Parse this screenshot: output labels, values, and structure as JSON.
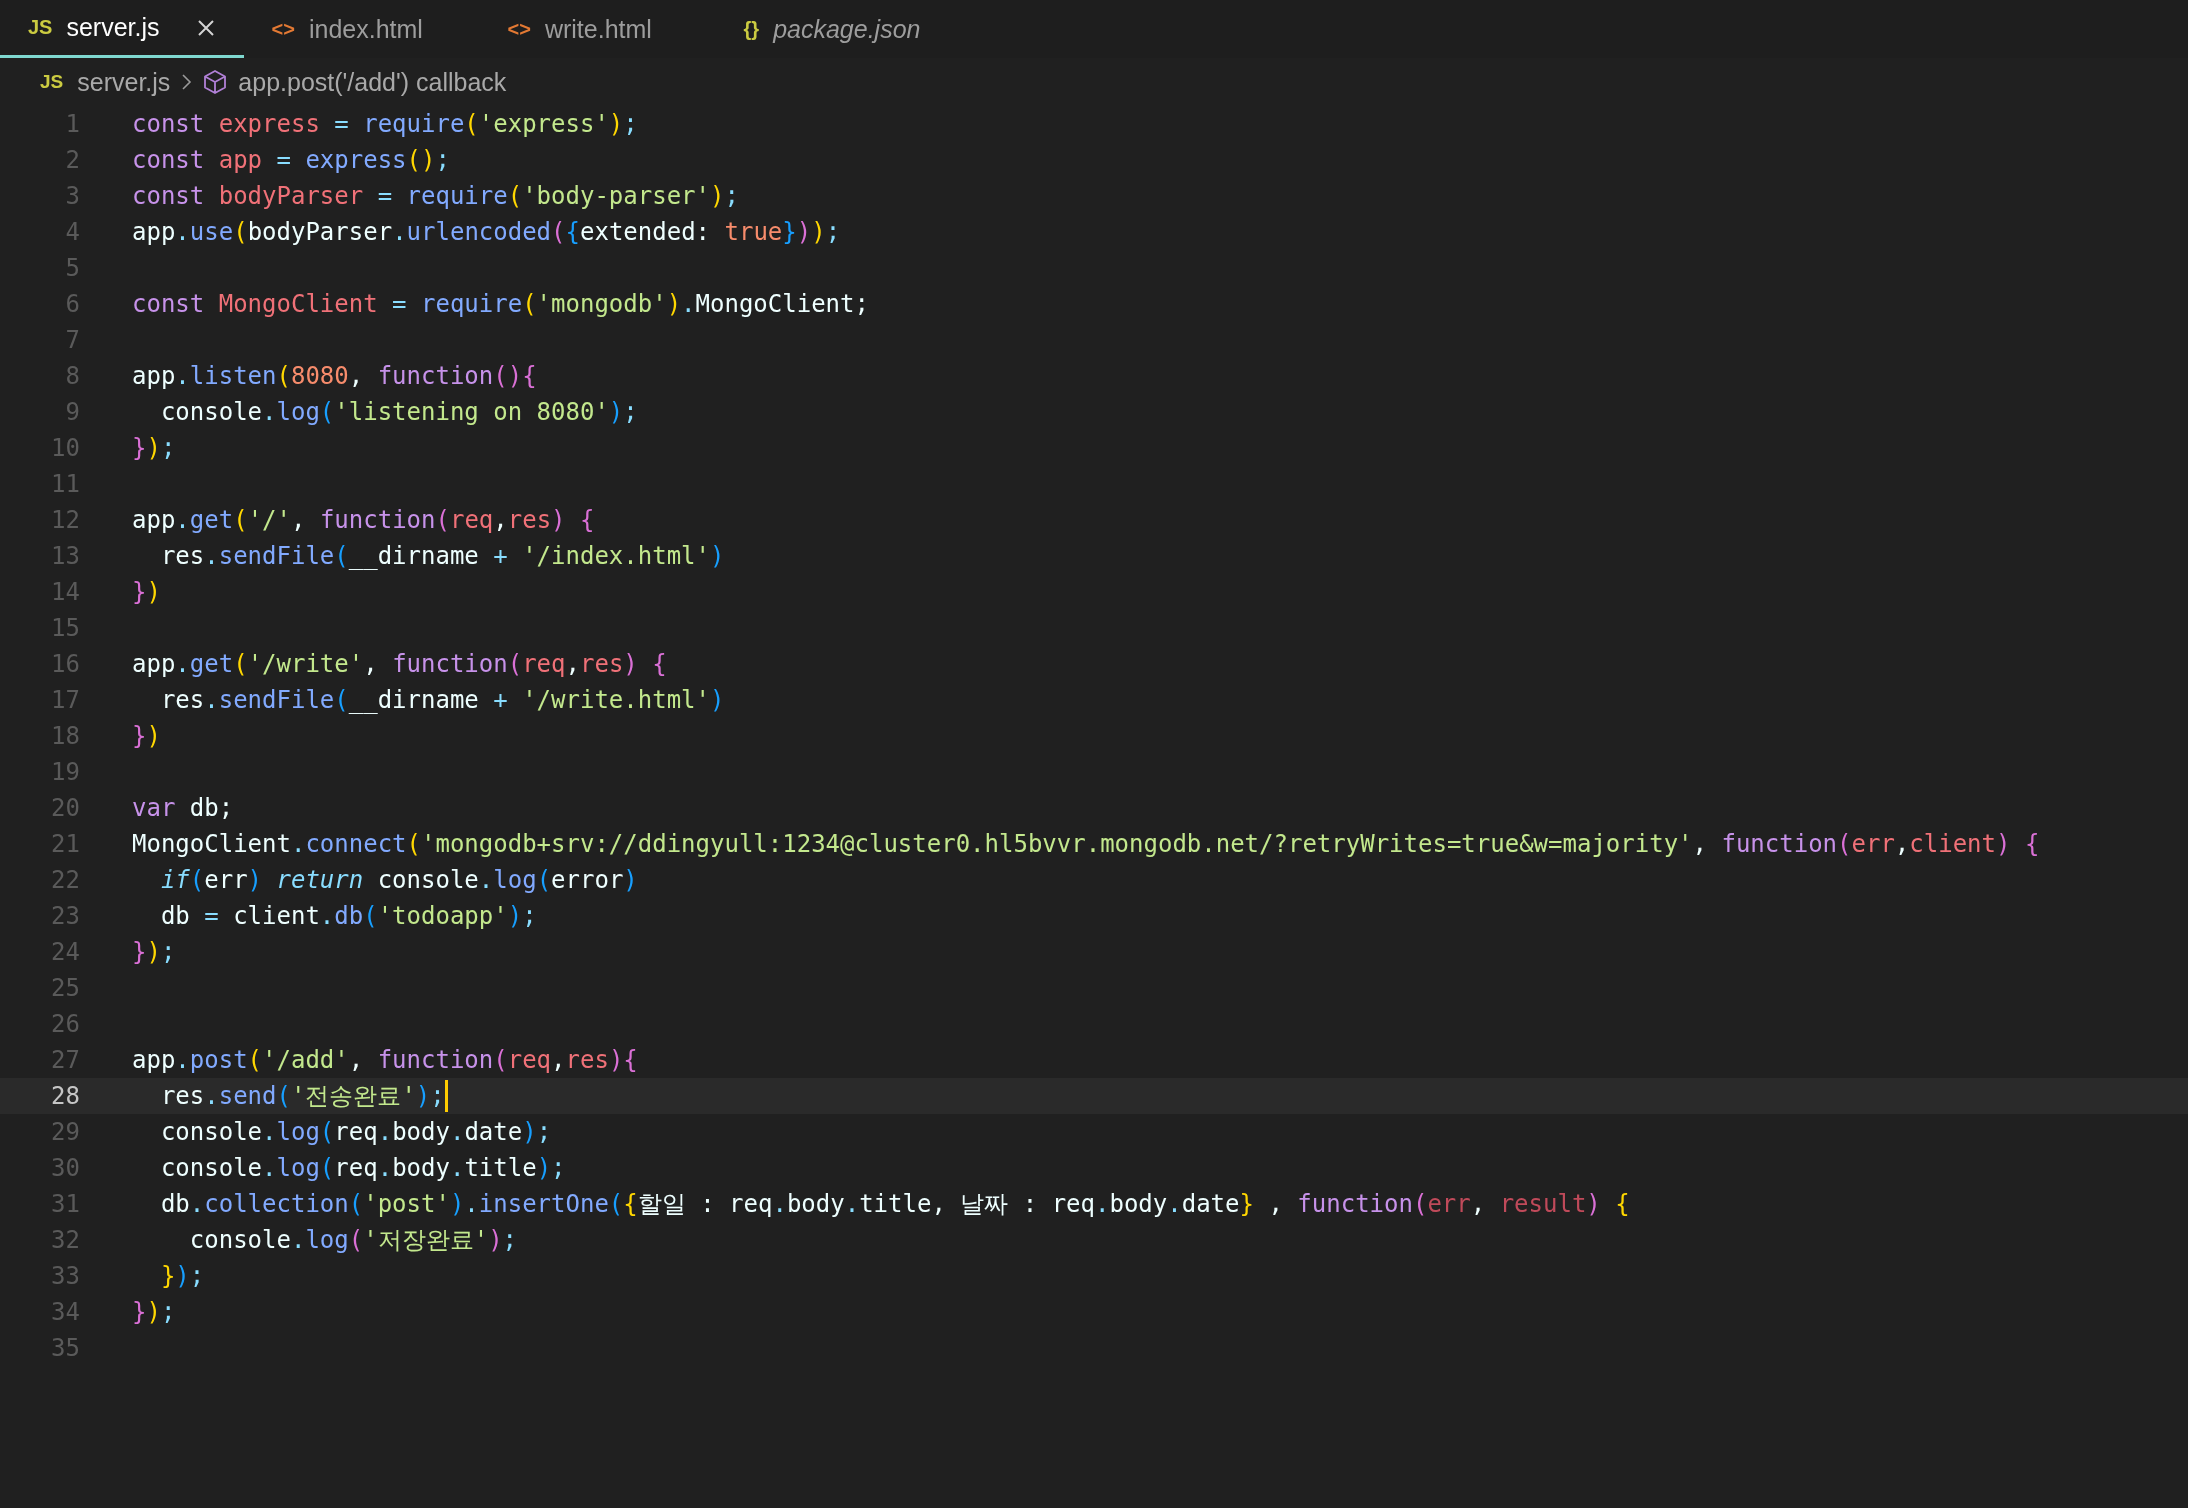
{
  "tabs": [
    {
      "icon": "JS",
      "kind": "js",
      "label": "server.js",
      "selected": true,
      "preview": false
    },
    {
      "icon": "<>",
      "kind": "html",
      "label": "index.html",
      "selected": false,
      "preview": false
    },
    {
      "icon": "<>",
      "kind": "html",
      "label": "write.html",
      "selected": false,
      "preview": false
    },
    {
      "icon": "{}",
      "kind": "json",
      "label": "package.json",
      "selected": false,
      "preview": true
    }
  ],
  "breadcrumb": {
    "file_icon": "JS",
    "file": "server.js",
    "symbol": "app.post('/add') callback"
  },
  "lines": [
    {
      "number": "1",
      "selected": false,
      "tokens": [
        {
          "text": "const",
          "kind": "kw"
        },
        {
          "text": " express",
          "kind": "decl"
        },
        {
          "text": " = ",
          "kind": "op"
        },
        {
          "text": "require",
          "kind": "fn"
        },
        {
          "text": "(",
          "kind": "b1"
        },
        {
          "text": "'express'",
          "kind": "str"
        },
        {
          "text": ")",
          "kind": "b1"
        },
        {
          "text": ";",
          "kind": "op"
        }
      ]
    },
    {
      "number": "2",
      "selected": false,
      "tokens": [
        {
          "text": "const",
          "kind": "kw"
        },
        {
          "text": " app",
          "kind": "decl"
        },
        {
          "text": " = ",
          "kind": "op"
        },
        {
          "text": "express",
          "kind": "fn"
        },
        {
          "text": "()",
          "kind": "b1"
        },
        {
          "text": ";",
          "kind": "op"
        }
      ]
    },
    {
      "number": "3",
      "selected": false,
      "tokens": [
        {
          "text": "const",
          "kind": "kw"
        },
        {
          "text": " bodyParser",
          "kind": "decl"
        },
        {
          "text": " = ",
          "kind": "op"
        },
        {
          "text": "require",
          "kind": "fn"
        },
        {
          "text": "(",
          "kind": "b1"
        },
        {
          "text": "'body-parser'",
          "kind": "str"
        },
        {
          "text": ")",
          "kind": "b1"
        },
        {
          "text": ";",
          "kind": "op"
        }
      ]
    },
    {
      "number": "4",
      "selected": false,
      "tokens": [
        {
          "text": "app",
          "kind": "plain"
        },
        {
          "text": ".",
          "kind": "op"
        },
        {
          "text": "use",
          "kind": "fn"
        },
        {
          "text": "(",
          "kind": "b1"
        },
        {
          "text": "bodyParser",
          "kind": "plain"
        },
        {
          "text": ".",
          "kind": "op"
        },
        {
          "text": "urlencoded",
          "kind": "fn"
        },
        {
          "text": "(",
          "kind": "b2"
        },
        {
          "text": "{",
          "kind": "b3"
        },
        {
          "text": "extended: ",
          "kind": "plain"
        },
        {
          "text": "true",
          "kind": "num"
        },
        {
          "text": "}",
          "kind": "b3"
        },
        {
          "text": ")",
          "kind": "b2"
        },
        {
          "text": ")",
          "kind": "b1"
        },
        {
          "text": ";",
          "kind": "op"
        }
      ]
    },
    {
      "number": "5",
      "selected": false
    },
    {
      "number": "6",
      "selected": false,
      "tokens": [
        {
          "text": "const",
          "kind": "kw"
        },
        {
          "text": " MongoClient",
          "kind": "decl"
        },
        {
          "text": " = ",
          "kind": "op"
        },
        {
          "text": "require",
          "kind": "fn"
        },
        {
          "text": "(",
          "kind": "b1"
        },
        {
          "text": "'mongodb'",
          "kind": "str"
        },
        {
          "text": ")",
          "kind": "b1"
        },
        {
          "text": ".",
          "kind": "op"
        },
        {
          "text": "MongoClient;",
          "kind": "plain"
        }
      ]
    },
    {
      "number": "7",
      "selected": false
    },
    {
      "number": "8",
      "selected": false,
      "tokens": [
        {
          "text": "app",
          "kind": "plain"
        },
        {
          "text": ".",
          "kind": "op"
        },
        {
          "text": "listen",
          "kind": "fn"
        },
        {
          "text": "(",
          "kind": "b1"
        },
        {
          "text": "8080",
          "kind": "num"
        },
        {
          "text": ", ",
          "kind": "plain"
        },
        {
          "text": "function",
          "kind": "kw"
        },
        {
          "text": "(){",
          "kind": "b2"
        }
      ]
    },
    {
      "number": "9",
      "selected": false,
      "tokens": [
        {
          "text": "  console",
          "kind": "plain"
        },
        {
          "text": ".",
          "kind": "op"
        },
        {
          "text": "log",
          "kind": "fn"
        },
        {
          "text": "(",
          "kind": "b3"
        },
        {
          "text": "'listening on 8080'",
          "kind": "str"
        },
        {
          "text": ")",
          "kind": "b3"
        },
        {
          "text": ";",
          "kind": "op"
        }
      ]
    },
    {
      "number": "10",
      "selected": false,
      "tokens": [
        {
          "text": "}",
          "kind": "b2"
        },
        {
          "text": ")",
          "kind": "b1"
        },
        {
          "text": ";",
          "kind": "op"
        }
      ]
    },
    {
      "number": "11",
      "selected": false
    },
    {
      "number": "12",
      "selected": false,
      "tokens": [
        {
          "text": "app",
          "kind": "plain"
        },
        {
          "text": ".",
          "kind": "op"
        },
        {
          "text": "get",
          "kind": "fn"
        },
        {
          "text": "(",
          "kind": "b1"
        },
        {
          "text": "'/'",
          "kind": "str"
        },
        {
          "text": ", ",
          "kind": "plain"
        },
        {
          "text": "function",
          "kind": "kw"
        },
        {
          "text": "(",
          "kind": "b2"
        },
        {
          "text": "req",
          "kind": "param"
        },
        {
          "text": ",",
          "kind": "plain"
        },
        {
          "text": "res",
          "kind": "param"
        },
        {
          "text": ")",
          "kind": "b2"
        },
        {
          "text": " {",
          "kind": "b2"
        }
      ]
    },
    {
      "number": "13",
      "selected": false,
      "tokens": [
        {
          "text": "  res",
          "kind": "plain"
        },
        {
          "text": ".",
          "kind": "op"
        },
        {
          "text": "sendFile",
          "kind": "fn"
        },
        {
          "text": "(",
          "kind": "b3"
        },
        {
          "text": "__dirname",
          "kind": "plain"
        },
        {
          "text": " + ",
          "kind": "op"
        },
        {
          "text": "'/index.html'",
          "kind": "str"
        },
        {
          "text": ")",
          "kind": "b3"
        }
      ]
    },
    {
      "number": "14",
      "selected": false,
      "tokens": [
        {
          "text": "}",
          "kind": "b2"
        },
        {
          "text": ")",
          "kind": "b1"
        }
      ]
    },
    {
      "number": "15",
      "selected": false
    },
    {
      "number": "16",
      "selected": false,
      "tokens": [
        {
          "text": "app",
          "kind": "plain"
        },
        {
          "text": ".",
          "kind": "op"
        },
        {
          "text": "get",
          "kind": "fn"
        },
        {
          "text": "(",
          "kind": "b1"
        },
        {
          "text": "'/write'",
          "kind": "str"
        },
        {
          "text": ", ",
          "kind": "plain"
        },
        {
          "text": "function",
          "kind": "kw"
        },
        {
          "text": "(",
          "kind": "b2"
        },
        {
          "text": "req",
          "kind": "param"
        },
        {
          "text": ",",
          "kind": "plain"
        },
        {
          "text": "res",
          "kind": "param"
        },
        {
          "text": ")",
          "kind": "b2"
        },
        {
          "text": " {",
          "kind": "b2"
        }
      ]
    },
    {
      "number": "17",
      "selected": false,
      "tokens": [
        {
          "text": "  res",
          "kind": "plain"
        },
        {
          "text": ".",
          "kind": "op"
        },
        {
          "text": "sendFile",
          "kind": "fn"
        },
        {
          "text": "(",
          "kind": "b3"
        },
        {
          "text": "__dirname",
          "kind": "plain"
        },
        {
          "text": " + ",
          "kind": "op"
        },
        {
          "text": "'/write.html'",
          "kind": "str"
        },
        {
          "text": ")",
          "kind": "b3"
        }
      ]
    },
    {
      "number": "18",
      "selected": false,
      "tokens": [
        {
          "text": "}",
          "kind": "b2"
        },
        {
          "text": ")",
          "kind": "b1"
        }
      ]
    },
    {
      "number": "19",
      "selected": false
    },
    {
      "number": "20",
      "selected": false,
      "tokens": [
        {
          "text": "var",
          "kind": "kw"
        },
        {
          "text": " db;",
          "kind": "plain"
        }
      ]
    },
    {
      "number": "21",
      "selected": false,
      "tokens": [
        {
          "text": "MongoClient",
          "kind": "plain"
        },
        {
          "text": ".",
          "kind": "op"
        },
        {
          "text": "connect",
          "kind": "fn"
        },
        {
          "text": "(",
          "kind": "b1"
        },
        {
          "text": "'mongodb+srv://ddingyull:1234@cluster0.hl5bvvr.mongodb.net/?retryWrites=true&w=majority'",
          "kind": "str"
        },
        {
          "text": ", ",
          "kind": "plain"
        },
        {
          "text": "function",
          "kind": "kw"
        },
        {
          "text": "(",
          "kind": "b2"
        },
        {
          "text": "err",
          "kind": "param"
        },
        {
          "text": ",",
          "kind": "plain"
        },
        {
          "text": "client",
          "kind": "param"
        },
        {
          "text": ")",
          "kind": "b2"
        },
        {
          "text": " {",
          "kind": "b2"
        }
      ]
    },
    {
      "number": "22",
      "selected": false,
      "tokens": [
        {
          "text": "  if",
          "kind": "ctrl"
        },
        {
          "text": "(",
          "kind": "b3"
        },
        {
          "text": "err",
          "kind": "plain"
        },
        {
          "text": ")",
          "kind": "b3"
        },
        {
          "text": " return",
          "kind": "ctrl"
        },
        {
          "text": " console",
          "kind": "plain"
        },
        {
          "text": ".",
          "kind": "op"
        },
        {
          "text": "log",
          "kind": "fn"
        },
        {
          "text": "(",
          "kind": "b3"
        },
        {
          "text": "error",
          "kind": "plain"
        },
        {
          "text": ")",
          "kind": "b3"
        }
      ]
    },
    {
      "number": "23",
      "selected": false,
      "tokens": [
        {
          "text": "  db",
          "kind": "plain"
        },
        {
          "text": " = ",
          "kind": "op"
        },
        {
          "text": "client",
          "kind": "plain"
        },
        {
          "text": ".",
          "kind": "op"
        },
        {
          "text": "db",
          "kind": "fn"
        },
        {
          "text": "(",
          "kind": "b3"
        },
        {
          "text": "'todoapp'",
          "kind": "str"
        },
        {
          "text": ")",
          "kind": "b3"
        },
        {
          "text": ";",
          "kind": "op"
        }
      ]
    },
    {
      "number": "24",
      "selected": false,
      "tokens": [
        {
          "text": "}",
          "kind": "b2"
        },
        {
          "text": ")",
          "kind": "b1"
        },
        {
          "text": ";",
          "kind": "op"
        }
      ]
    },
    {
      "number": "25",
      "selected": false
    },
    {
      "number": "26",
      "selected": false
    },
    {
      "number": "27",
      "selected": false,
      "tokens": [
        {
          "text": "app",
          "kind": "plain"
        },
        {
          "text": ".",
          "kind": "op"
        },
        {
          "text": "post",
          "kind": "fn"
        },
        {
          "text": "(",
          "kind": "b1"
        },
        {
          "text": "'/add'",
          "kind": "str"
        },
        {
          "text": ", ",
          "kind": "plain"
        },
        {
          "text": "function",
          "kind": "kw"
        },
        {
          "text": "(",
          "kind": "b2"
        },
        {
          "text": "req",
          "kind": "param"
        },
        {
          "text": ",",
          "kind": "plain"
        },
        {
          "text": "res",
          "kind": "param"
        },
        {
          "text": ")",
          "kind": "b2"
        },
        {
          "text": "{",
          "kind": "b2"
        }
      ]
    },
    {
      "number": "28",
      "selected": true,
      "tokens": [
        {
          "text": "  res",
          "kind": "plain"
        },
        {
          "text": ".",
          "kind": "op"
        },
        {
          "text": "send",
          "kind": "fn"
        },
        {
          "text": "(",
          "kind": "b3"
        },
        {
          "text": "'전송완료'",
          "kind": "str"
        },
        {
          "text": ")",
          "kind": "b3"
        },
        {
          "text": ";",
          "kind": "op"
        }
      ]
    },
    {
      "number": "29",
      "selected": false,
      "tokens": [
        {
          "text": "  console",
          "kind": "plain"
        },
        {
          "text": ".",
          "kind": "op"
        },
        {
          "text": "log",
          "kind": "fn"
        },
        {
          "text": "(",
          "kind": "b3"
        },
        {
          "text": "req",
          "kind": "plain"
        },
        {
          "text": ".",
          "kind": "op"
        },
        {
          "text": "body",
          "kind": "plain"
        },
        {
          "text": ".",
          "kind": "op"
        },
        {
          "text": "date",
          "kind": "plain"
        },
        {
          "text": ")",
          "kind": "b3"
        },
        {
          "text": ";",
          "kind": "op"
        }
      ]
    },
    {
      "number": "30",
      "selected": false,
      "tokens": [
        {
          "text": "  console",
          "kind": "plain"
        },
        {
          "text": ".",
          "kind": "op"
        },
        {
          "text": "log",
          "kind": "fn"
        },
        {
          "text": "(",
          "kind": "b3"
        },
        {
          "text": "req",
          "kind": "plain"
        },
        {
          "text": ".",
          "kind": "op"
        },
        {
          "text": "body",
          "kind": "plain"
        },
        {
          "text": ".",
          "kind": "op"
        },
        {
          "text": "title",
          "kind": "plain"
        },
        {
          "text": ")",
          "kind": "b3"
        },
        {
          "text": ";",
          "kind": "op"
        }
      ]
    },
    {
      "number": "31",
      "selected": false,
      "tokens": [
        {
          "text": "  db",
          "kind": "plain"
        },
        {
          "text": ".",
          "kind": "op"
        },
        {
          "text": "collection",
          "kind": "fn"
        },
        {
          "text": "(",
          "kind": "b3"
        },
        {
          "text": "'post'",
          "kind": "str"
        },
        {
          "text": ")",
          "kind": "b3"
        },
        {
          "text": ".",
          "kind": "op"
        },
        {
          "text": "insertOne",
          "kind": "fn"
        },
        {
          "text": "(",
          "kind": "b3"
        },
        {
          "text": "{",
          "kind": "b1"
        },
        {
          "text": "할일 : req",
          "kind": "plain"
        },
        {
          "text": ".",
          "kind": "op"
        },
        {
          "text": "body",
          "kind": "plain"
        },
        {
          "text": ".",
          "kind": "op"
        },
        {
          "text": "title, 날짜 : req",
          "kind": "plain"
        },
        {
          "text": ".",
          "kind": "op"
        },
        {
          "text": "body",
          "kind": "plain"
        },
        {
          "text": ".",
          "kind": "op"
        },
        {
          "text": "date",
          "kind": "plain"
        },
        {
          "text": "}",
          "kind": "b1"
        },
        {
          "text": " , ",
          "kind": "plain"
        },
        {
          "text": "function",
          "kind": "kw"
        },
        {
          "text": "(",
          "kind": "b2"
        },
        {
          "text": "err",
          "kind": "param2"
        },
        {
          "text": ", ",
          "kind": "plain"
        },
        {
          "text": "result",
          "kind": "param2"
        },
        {
          "text": ")",
          "kind": "b2"
        },
        {
          "text": " {",
          "kind": "b1"
        }
      ]
    },
    {
      "number": "32",
      "selected": false,
      "tokens": [
        {
          "text": "    console",
          "kind": "plain"
        },
        {
          "text": ".",
          "kind": "op"
        },
        {
          "text": "log",
          "kind": "fn"
        },
        {
          "text": "(",
          "kind": "b2"
        },
        {
          "text": "'저장완료'",
          "kind": "str"
        },
        {
          "text": ")",
          "kind": "b2"
        },
        {
          "text": ";",
          "kind": "op"
        }
      ]
    },
    {
      "number": "33",
      "selected": false,
      "tokens": [
        {
          "text": "  }",
          "kind": "b1"
        },
        {
          "text": ")",
          "kind": "b3"
        },
        {
          "text": ";",
          "kind": "op"
        }
      ]
    },
    {
      "number": "34",
      "selected": false,
      "tokens": [
        {
          "text": "}",
          "kind": "b2"
        },
        {
          "text": ")",
          "kind": "b1"
        },
        {
          "text": ";",
          "kind": "op"
        }
      ]
    },
    {
      "number": "35",
      "selected": false
    }
  ]
}
